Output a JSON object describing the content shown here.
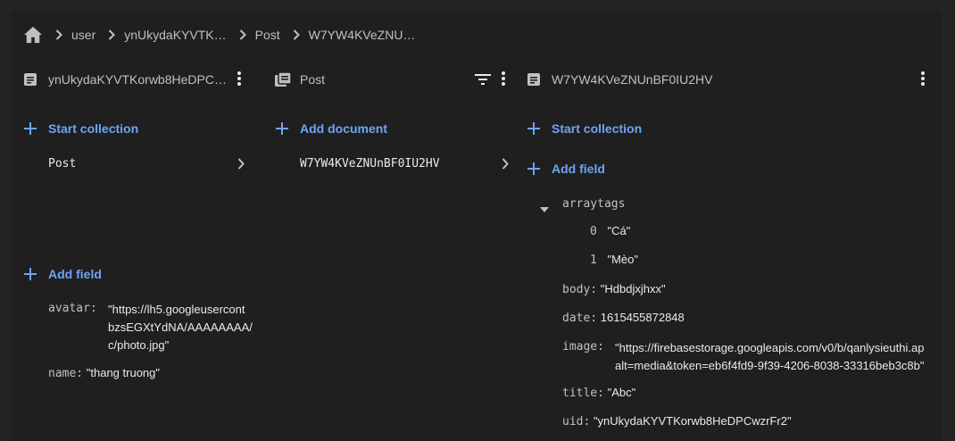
{
  "breadcrumb": {
    "items": [
      "user",
      "ynUkydaKYVTK…",
      "Post",
      "W7YW4KVeZNU…"
    ]
  },
  "col1": {
    "title": "ynUkydaKYVTKorwb8HeDPCw…",
    "start_collection": "Start collection",
    "collections": [
      "Post"
    ],
    "add_field": "Add field",
    "fields": [
      {
        "key": "avatar:",
        "lines": [
          "\"https://lh5.googleusercont",
          "bzsEGXtYdNA/AAAAAAAA/",
          "c/photo.jpg\""
        ]
      },
      {
        "key": "name:",
        "value": "\"thang truong\""
      }
    ]
  },
  "col2": {
    "title": "Post",
    "add_document": "Add document",
    "documents": [
      "W7YW4KVeZNUnBF0IU2HV"
    ]
  },
  "col3": {
    "title": "W7YW4KVeZNUnBF0IU2HV",
    "start_collection": "Start collection",
    "add_field": "Add field",
    "arraytags_key": "arraytags",
    "arraytags": [
      {
        "index": "0",
        "value": "\"Cá\""
      },
      {
        "index": "1",
        "value": "\"Mèo\""
      }
    ],
    "fields": [
      {
        "key": "body:",
        "value": "\"Hdbdjxjhxx\""
      },
      {
        "key": "date:",
        "value": "1615455872848"
      },
      {
        "key": "image:",
        "lines": [
          "\"https://firebasestorage.googleapis.com/v0/b/qanlysieuthi.ap",
          "alt=media&token=eb6f4fd9-9f39-4206-8038-33316beb3c8b\""
        ]
      },
      {
        "key": "title:",
        "value": "\"Abc\""
      },
      {
        "key": "uid:",
        "value": "\"ynUkydaKYVTKorwb8HeDPCwzrFr2\""
      }
    ]
  },
  "colors": {
    "accent": "#6fa4f5",
    "panel": "#1f1f1f",
    "background": "#232323"
  }
}
